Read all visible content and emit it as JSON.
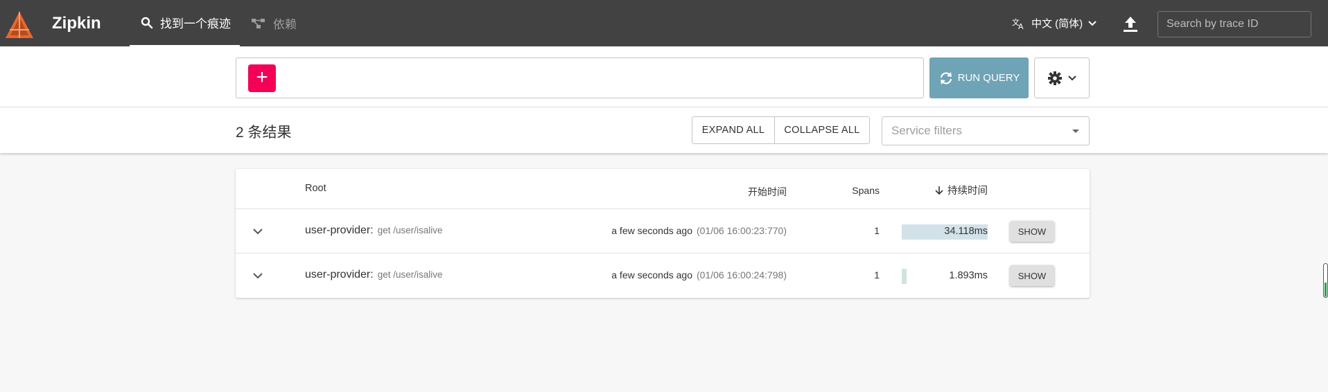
{
  "header": {
    "brand": "Zipkin",
    "tabs": [
      {
        "label": "找到一个痕迹",
        "icon": "search-icon",
        "active": true
      },
      {
        "label": "依赖",
        "icon": "dependencies-icon",
        "active": false
      }
    ],
    "language": "中文 (简体)",
    "trace_search_placeholder": "Search by trace ID"
  },
  "query": {
    "add_label": "+",
    "run_label": "RUN QUERY"
  },
  "results": {
    "count_label": "2 条结果",
    "expand_all": "EXPAND ALL",
    "collapse_all": "COLLAPSE ALL",
    "service_filter_placeholder": "Service filters"
  },
  "table": {
    "headers": {
      "root": "Root",
      "start": "开始时间",
      "spans": "Spans",
      "duration": "持续时间"
    },
    "rows": [
      {
        "service": "user-provider:",
        "span_name": "get /user/isalive",
        "start_relative": "a few seconds ago",
        "start_abs": "(01/06 16:00:23:770)",
        "spans": "1",
        "duration": "34.118ms",
        "duration_fraction": 1.0,
        "action": "SHOW"
      },
      {
        "service": "user-provider:",
        "span_name": "get /user/isalive",
        "start_relative": "a few seconds ago",
        "start_abs": "(01/06 16:00:24:798)",
        "spans": "1",
        "duration": "1.893ms",
        "duration_fraction": 0.055,
        "action": "SHOW"
      }
    ]
  },
  "colors": {
    "header_bg": "#424242",
    "accent_pink": "#f50057",
    "run_query": "#6fa3b6",
    "logo_orange": "#e8672d"
  }
}
